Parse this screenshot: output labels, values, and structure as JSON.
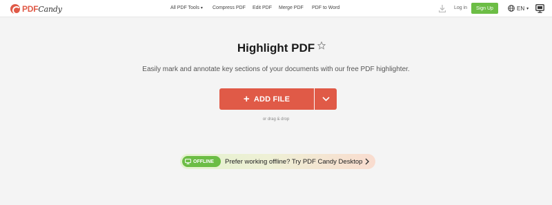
{
  "header": {
    "logo_pdf": "PDF",
    "logo_candy": "Candy",
    "nav": [
      {
        "label": "All PDF Tools",
        "has_caret": true
      },
      {
        "label": "Compress PDF"
      },
      {
        "label": "Edit PDF"
      },
      {
        "label": "Merge PDF"
      },
      {
        "label": "PDF to Word"
      }
    ],
    "login_label": "Log in",
    "signup_label": "Sign Up",
    "language": "EN",
    "caret": "▾"
  },
  "main": {
    "title": "Highlight PDF",
    "subtitle": "Easily mark and annotate key sections of your documents with our free PDF highlighter.",
    "add_file_label": "ADD FILE",
    "add_file_plus": "+",
    "drag_text": "or drag & drop"
  },
  "offline": {
    "badge": "OFFLINE",
    "text": "Prefer working offline? Try PDF Candy Desktop"
  },
  "colors": {
    "accent": "#e05a47",
    "green": "#6cbd45",
    "background": "#f4f4f4"
  },
  "icons": [
    "download-icon",
    "globe-icon",
    "desktop-icon",
    "star-icon",
    "chevron-down-icon",
    "monitor-icon",
    "chevron-right-icon"
  ]
}
